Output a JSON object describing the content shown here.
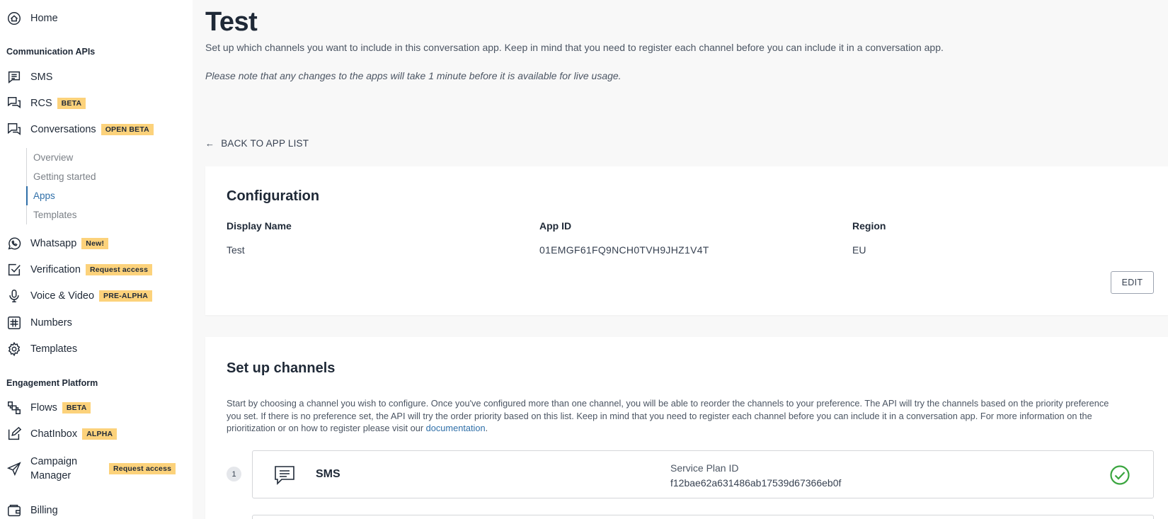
{
  "sidebar": {
    "home": "Home",
    "section_comm": "Communication APIs",
    "sms": "SMS",
    "rcs": "RCS",
    "rcs_badge": "BETA",
    "conversations": "Conversations",
    "conversations_badge": "OPEN BETA",
    "sub": [
      "Overview",
      "Getting started",
      "Apps",
      "Templates"
    ],
    "whatsapp": "Whatsapp",
    "whatsapp_badge": "New!",
    "verification": "Verification",
    "verification_badge": "Request access",
    "voice": "Voice & Video",
    "voice_badge": "PRE-ALPHA",
    "numbers": "Numbers",
    "templates": "Templates",
    "section_engage": "Engagement Platform",
    "flows": "Flows",
    "flows_badge": "BETA",
    "chatinbox": "ChatInbox",
    "chatinbox_badge": "ALPHA",
    "campaign_line1": "Campaign",
    "campaign_line2": "Manager",
    "campaign_badge": "Request access",
    "billing": "Billing"
  },
  "main": {
    "title": "Test",
    "subtitle": "Set up which channels you want to include in this conversation app. Keep in mind that you need to register each channel before you can include it in a conversation app.",
    "note": "Please note that any changes to the apps will take 1 minute before it is available for live usage.",
    "back": "BACK TO APP LIST"
  },
  "config": {
    "title": "Configuration",
    "display_name_label": "Display Name",
    "display_name": "Test",
    "app_id_label": "App ID",
    "app_id": "01EMGF61FQ9NCH0TVH9JHZ1V4T",
    "region_label": "Region",
    "region": "EU",
    "edit": "EDIT"
  },
  "channels": {
    "title": "Set up channels",
    "desc_before": "Start by choosing a channel you wish to configure. Once you've configured more than one channel, you will be able to reorder the channels to your preference. The API will try the channels based on the priority preference you set. If there is no preference set, the API will try the order priority based on this list. Keep in mind that you need to register each channel before you can include it in a conversation app. For more information on the prioritization or on how to register please visit our ",
    "desc_link": "documentation",
    "desc_after": ".",
    "items": [
      {
        "index": "1",
        "name": "SMS",
        "field_label": "Service Plan ID",
        "field_value": "f12bae62a631486ab17539d67366eb0f"
      }
    ]
  },
  "colors": {
    "accent": "#2f6fa8",
    "badge": "#fcd27b",
    "success": "#3aa53f"
  }
}
